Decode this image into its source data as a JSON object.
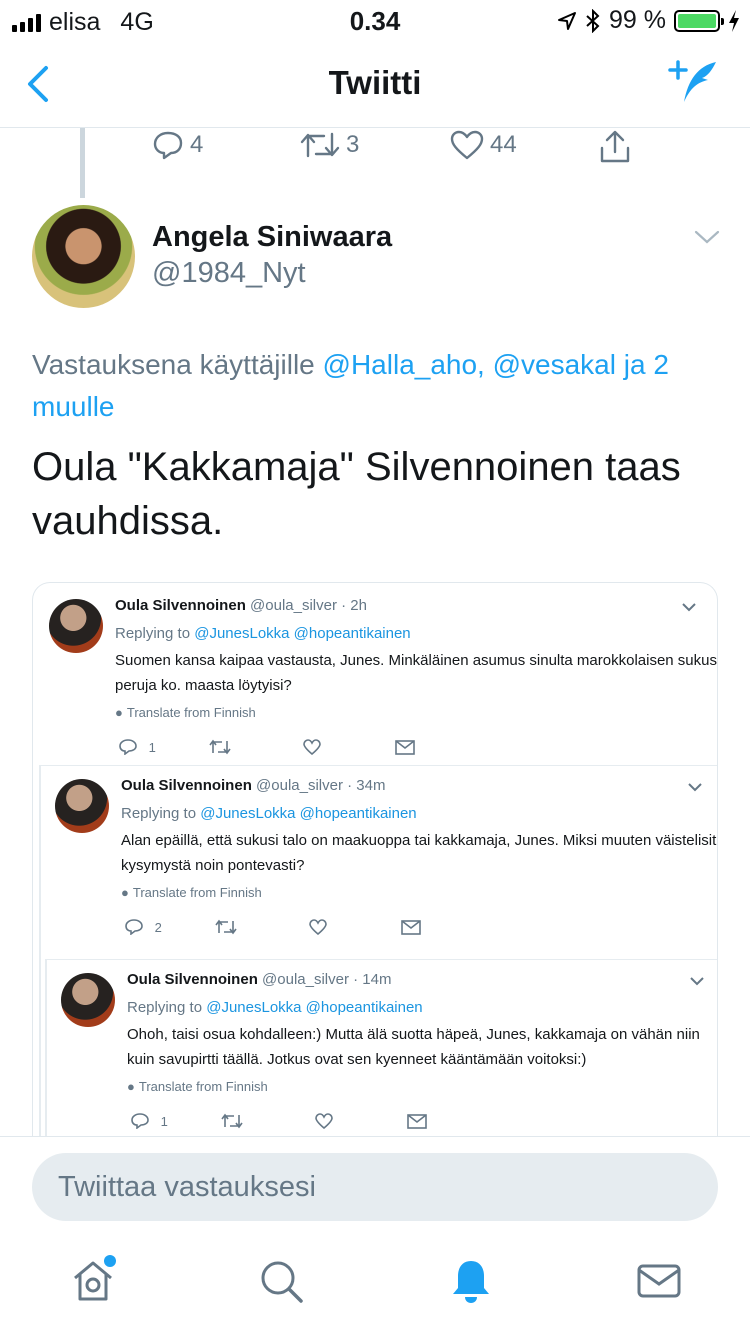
{
  "status": {
    "carrier": "elisa",
    "network": "4G",
    "time": "0.34",
    "battery": "99 %",
    "battery_level": 0.99
  },
  "nav": {
    "title": "Twiitti"
  },
  "prev_tweet": {
    "replies": "4",
    "retweets": "3",
    "likes": "44"
  },
  "tweet": {
    "author_name": "Angela Siniwaara",
    "author_handle": "@1984_Nyt",
    "reply_prefix": "Vastauksena käyttäjille",
    "reply_links": "@Halla_aho, @vesakal ja 2 muulle",
    "text": "Oula \"Kakkamaja\" Silvennoinen taas vauhdissa."
  },
  "embedded": [
    {
      "name": "Oula Silvennoinen",
      "handle": "@oula_silver · 2h",
      "replying_label": "Replying to",
      "replying_to": "@JunesLokka @hopeantikainen",
      "text": "Suomen kansa kaipaa vastausta, Junes. Minkäläinen asumus sinulta marokkolaisen sukusi peruja ko. maasta löytyisi?",
      "translate": "Translate from Finnish",
      "replies": "1"
    },
    {
      "name": "Oula Silvennoinen",
      "handle": "@oula_silver · 34m",
      "replying_label": "Replying to",
      "replying_to": "@JunesLokka @hopeantikainen",
      "text": "Alan epäillä, että sukusi talo on maakuoppa tai kakkamaja, Junes. Miksi muuten väistelisit kysymystä noin pontevasti?",
      "translate": "Translate from Finnish",
      "replies": "2"
    },
    {
      "name": "Oula Silvennoinen",
      "handle": "@oula_silver · 14m",
      "replying_label": "Replying to",
      "replying_to": "@JunesLokka @hopeantikainen",
      "text": "Ohoh, taisi osua kohdalleen:) Mutta älä suotta häpeä, Junes, kakkamaja on vähän niin kuin savupirtti täällä. Jotkus ovat sen kyenneet kääntämään voitoksi:)",
      "translate": "Translate from Finnish",
      "replies": "1"
    }
  ],
  "reply_bar": {
    "placeholder": "Twiittaa vastauksesi"
  },
  "tabs": [
    "home-icon",
    "search-icon",
    "notifications-icon",
    "messages-icon"
  ],
  "colors": {
    "accent": "#1da1f2",
    "text": "#14171a",
    "muted": "#657786"
  }
}
